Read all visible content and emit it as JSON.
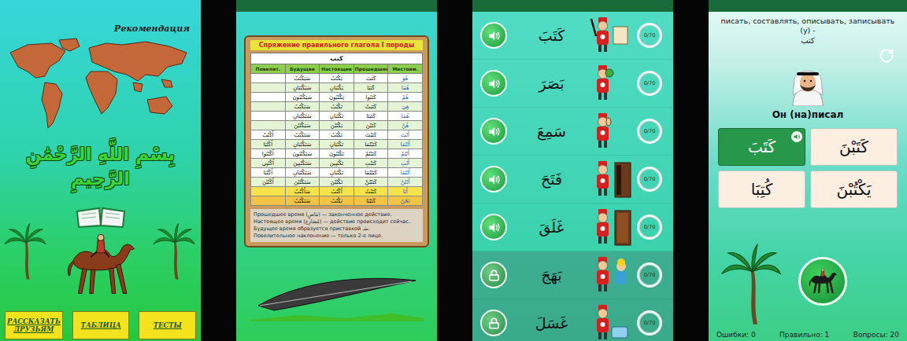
{
  "home": {
    "title": "Рекомендация",
    "bismillah": "بِسْمِ اللَّهِ الرَّحْمَٰنِ الرَّحِيمِ",
    "buttons": [
      "РАССКАЗАТЬ ДРУЗЬЯМ",
      "ТАБЛИЦА",
      "ТЕСТЫ"
    ]
  },
  "table_screen": {
    "title": "Спряжение правильного глагола I породы",
    "verb": "كتب",
    "columns": [
      "Повелит.",
      "Будущее",
      "Настоящее",
      "Прошедшее",
      "Местоим."
    ],
    "rows": [
      {
        "cells": [
          "",
          "سَيَكْتُبُ",
          "يَكْتُبُ",
          "كَتَبَ",
          "هُوَ"
        ],
        "color": "#ffffff"
      },
      {
        "cells": [
          "",
          "سَيَكْتُبَانِ",
          "يَكْتُبَانِ",
          "كَتَبَا",
          "هُمَا"
        ],
        "color": "#e4f4d4"
      },
      {
        "cells": [
          "",
          "سَيَكْتُبُونَ",
          "يَكْتُبُونَ",
          "كَتَبُوا",
          "هُمْ"
        ],
        "color": "#ffffff"
      },
      {
        "cells": [
          "",
          "سَتَكْتُبُ",
          "تَكْتُبُ",
          "كَتَبَتْ",
          "هِيَ"
        ],
        "color": "#e4f4d4"
      },
      {
        "cells": [
          "",
          "سَتَكْتُبَانِ",
          "تَكْتُبَانِ",
          "كَتَبَتَا",
          "هُمَا"
        ],
        "color": "#ffffff"
      },
      {
        "cells": [
          "",
          "سَيَكْتُبْنَ",
          "يَكْتُبْنَ",
          "كَتَبْنَ",
          "هُنَّ"
        ],
        "color": "#e4f4d4"
      },
      {
        "cells": [
          "اُكْتُبْ",
          "سَتَكْتُبُ",
          "تَكْتُبُ",
          "كَتَبْتَ",
          "أَنْتَ"
        ],
        "color": "#ffffff"
      },
      {
        "cells": [
          "اُكْتُبَا",
          "سَتَكْتُبَانِ",
          "تَكْتُبَانِ",
          "كَتَبْتُمَا",
          "أَنْتُمَا"
        ],
        "color": "#e4f4d4"
      },
      {
        "cells": [
          "اُكْتُبُوا",
          "سَتَكْتُبُونَ",
          "تَكْتُبُونَ",
          "كَتَبْتُمْ",
          "أَنْتُمْ"
        ],
        "color": "#ffffff"
      },
      {
        "cells": [
          "اُكْتُبِي",
          "سَتَكْتُبِينَ",
          "تَكْتُبِينَ",
          "كَتَبْتِ",
          "أَنْتِ"
        ],
        "color": "#e4f4d4"
      },
      {
        "cells": [
          "اُكْتُبَا",
          "سَتَكْتُبَانِ",
          "تَكْتُبَانِ",
          "كَتَبْتُمَا",
          "أَنْتُمَا"
        ],
        "color": "#ffffff"
      },
      {
        "cells": [
          "اُكْتُبْنَ",
          "سَتَكْتُبْنَ",
          "تَكْتُبْنَ",
          "كَتَبْتُنَّ",
          "أَنْتُنَّ"
        ],
        "color": "#e4f4d4"
      },
      {
        "cells": [
          "",
          "سَأَكْتُبُ",
          "أَكْتُبُ",
          "كَتَبْتُ",
          "أَنَا"
        ],
        "color": "#f6e24a"
      },
      {
        "cells": [
          "",
          "سَنَكْتُبُ",
          "نَكْتُبُ",
          "كَتَبْنَا",
          "نَحْنُ"
        ],
        "color": "#f3c444"
      }
    ],
    "notes": [
      "Прошедшее время (مَاضٍ) — законченное действие.",
      "Настоящее время (مُضَارِع) — действие происходит сейчас.",
      "Будущее время образуется приставкой سَـ.",
      "Повелительное наклонение — только 2-е лицо."
    ]
  },
  "verb_list": {
    "items": [
      {
        "verb": "كَتَبَ",
        "progress": "0/70",
        "locked": false
      },
      {
        "verb": "بَصَرَ",
        "progress": "0/70",
        "locked": false
      },
      {
        "verb": "سَمِعَ",
        "progress": "0/70",
        "locked": false
      },
      {
        "verb": "فَتَحَ",
        "progress": "0/70",
        "locked": false
      },
      {
        "verb": "غَلَقَ",
        "progress": "0/70",
        "locked": false
      },
      {
        "verb": "بَهَجَ",
        "progress": "0/70",
        "locked": true
      },
      {
        "verb": "غَسَلَ",
        "progress": "0/70",
        "locked": true
      }
    ]
  },
  "quiz": {
    "prompt": "писать, составлять, описывать, записывать (у) -",
    "prompt_word": "كتب",
    "question": "Он (на)писал",
    "answers": [
      {
        "text": "كَتَبَ",
        "selected": true
      },
      {
        "text": "كَتَبْنَ",
        "selected": false
      },
      {
        "text": "كُتِبَا",
        "selected": false
      },
      {
        "text": "يَكْتُبْنَ",
        "selected": false
      }
    ],
    "stats": [
      {
        "label": "Ошибки:",
        "value": "0"
      },
      {
        "label": "Правильно:",
        "value": "1"
      },
      {
        "label": "Вопросы:",
        "value": "20"
      }
    ]
  }
}
